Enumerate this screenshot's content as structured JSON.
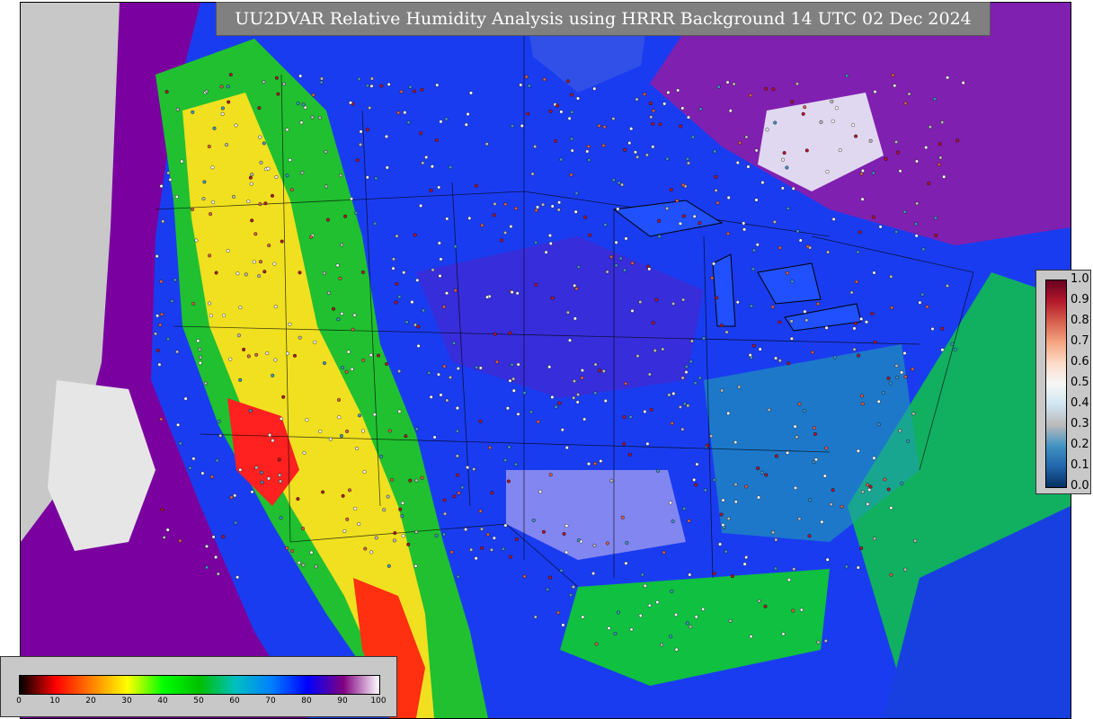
{
  "title": "UU2DVAR Relative Humidity Analysis using HRRR Background 14 UTC 02 Dec 2024",
  "observation_legend": {
    "ticks": [
      "1.0",
      "0.9",
      "0.8",
      "0.7",
      "0.6",
      "0.5",
      "0.4",
      "0.3",
      "0.2",
      "0.1",
      "0.0"
    ],
    "colors": [
      "#67001f",
      "#b2182b",
      "#d6604d",
      "#f4a582",
      "#fddbc7",
      "#f7f7f7",
      "#d1e5f0",
      "#bababa",
      "#4393c3",
      "#2166ac",
      "#053061"
    ]
  },
  "rh_legend": {
    "ticks": [
      "0",
      "10",
      "20",
      "30",
      "40",
      "50",
      "60",
      "70",
      "80",
      "90",
      "100"
    ],
    "colors": [
      "#000000",
      "#ff0000",
      "#ff8000",
      "#ffff00",
      "#00ff00",
      "#00c000",
      "#00c0c0",
      "#0080ff",
      "#0000ff",
      "#800080",
      "#ffffff"
    ]
  },
  "map_colors": {
    "ocean_left": "#c8c8c8",
    "ocean_pacific": "#6a00a8",
    "land_moist": "#1a3cf0",
    "gulf_green": "#10c040",
    "arid": "#ff2020"
  }
}
